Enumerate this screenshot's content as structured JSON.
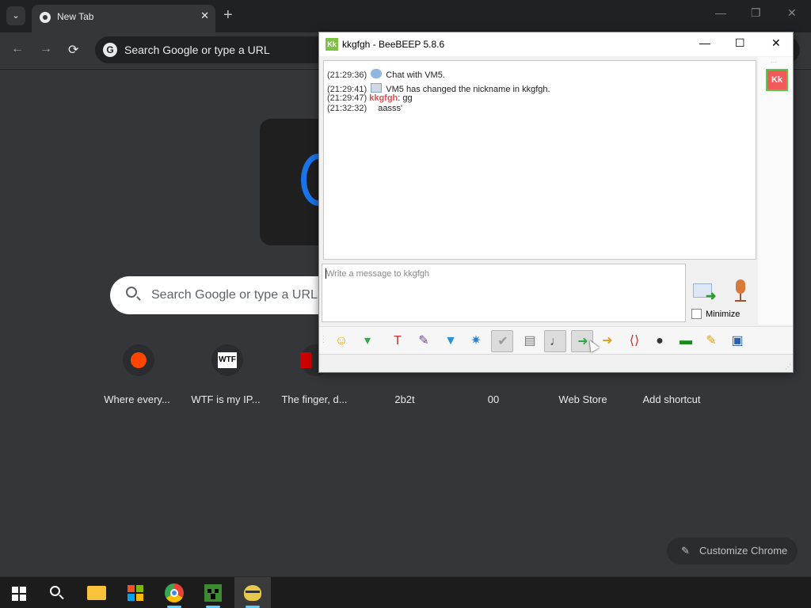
{
  "chrome": {
    "tab_title": "New Tab",
    "tab_close": "✕",
    "new_tab": "+",
    "tab_search": "⌄",
    "win_min": "—",
    "win_max": "❐",
    "win_close": "✕",
    "nav_back": "←",
    "nav_forward": "→",
    "nav_reload": "⟳",
    "omnibox_g": "G",
    "omnibox_placeholder": "Search Google or type a URL"
  },
  "ntp": {
    "search_placeholder": "Search Google or type a URL",
    "shortcuts": [
      {
        "label": "Where every...",
        "icon": "reddit-icon"
      },
      {
        "label": "WTF is my IP...",
        "icon": "wtf-icon",
        "icon_text": "WTF"
      },
      {
        "label": "The finger, d...",
        "icon": "red-site-icon"
      },
      {
        "label": "2b2t"
      },
      {
        "label": "00"
      },
      {
        "label": "Web Store"
      },
      {
        "label": "Add shortcut"
      }
    ],
    "customize_label": "Customize Chrome",
    "customize_icon": "✎"
  },
  "beebeep": {
    "logo": "Kk",
    "title": "kkgfgh - BeeBEEP 5.8.6",
    "ctl_min": "—",
    "ctl_max": "☐",
    "ctl_close": "✕",
    "messages": [
      {
        "time": "(21:29:36)",
        "text": "Chat with VM5."
      },
      {
        "time": "(21:29:41)",
        "text": "VM5 has changed the nickname in kkgfgh."
      },
      {
        "time": "(21:29:47)",
        "nick": "kkgfgh",
        "text": ": gg"
      },
      {
        "time": "(21:32:32)",
        "text": "aasss'"
      }
    ],
    "input_placeholder": "Write a message to kkgfgh",
    "minimize_label": "Minimize",
    "user_avatar": "Kk",
    "toolbar": [
      {
        "name": "emoticon-icon",
        "glyph": "☺",
        "color": "#e8a40c"
      },
      {
        "name": "bell-icon",
        "glyph": "▾",
        "color": "#2ea84a"
      },
      {
        "name": "font-icon",
        "glyph": "T",
        "color": "#c9302c"
      },
      {
        "name": "color-icon",
        "glyph": "✎",
        "color": "#7a3fb0"
      },
      {
        "name": "filter-icon",
        "glyph": "▼",
        "color": "#2b8fd1"
      },
      {
        "name": "settings-icon",
        "glyph": "✷",
        "color": "#2b7fd1"
      },
      {
        "name": "spellcheck-icon",
        "glyph": "✔",
        "color": "#999999",
        "pressed": true
      },
      {
        "name": "dictionary-icon",
        "glyph": "▤",
        "color": "#777777"
      },
      {
        "name": "music-note-icon",
        "glyph": "♩",
        "color": "#444444",
        "pressed": true
      },
      {
        "name": "send-file-icon",
        "glyph": "➜",
        "color": "#2ea84a",
        "pressed": true
      },
      {
        "name": "send-folder-icon",
        "glyph": "➜",
        "color": "#d9a32b"
      },
      {
        "name": "html-icon",
        "glyph": "⟨⟩",
        "color": "#c9302c"
      },
      {
        "name": "screenshot-icon",
        "glyph": "●",
        "color": "#333333"
      },
      {
        "name": "terminal-icon",
        "glyph": "▬",
        "color": "#1a8a1a"
      },
      {
        "name": "note-icon",
        "glyph": "✎",
        "color": "#d9a32b"
      },
      {
        "name": "save-icon",
        "glyph": "▣",
        "color": "#2b5fb0"
      }
    ]
  }
}
